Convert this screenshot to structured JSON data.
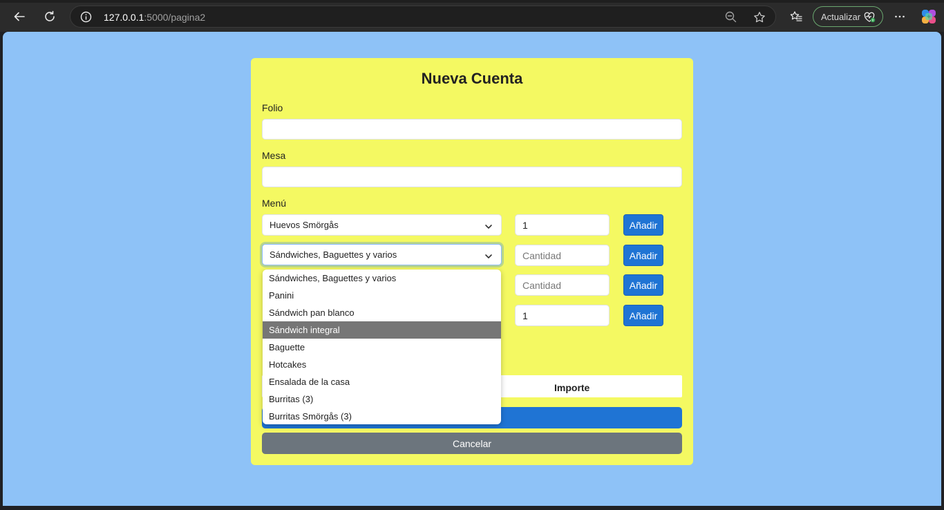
{
  "browser": {
    "url_host": "127.0.0.1",
    "url_path": ":5000/pagina2",
    "update_label": "Actualizar"
  },
  "form": {
    "title": "Nueva Cuenta",
    "folio_label": "Folio",
    "folio_value": "",
    "mesa_label": "Mesa",
    "mesa_value": "",
    "menu_label": "Menú",
    "rows": [
      {
        "selected": "Huevos Smörgås",
        "quantity": "1",
        "quantity_placeholder": "Cantidad",
        "add_label": "Añadir"
      },
      {
        "selected": "Sándwiches, Baguettes y varios",
        "quantity": "",
        "quantity_placeholder": "Cantidad",
        "add_label": "Añadir"
      },
      {
        "selected": "",
        "quantity": "",
        "quantity_placeholder": "Cantidad",
        "add_label": "Añadir"
      },
      {
        "selected": "",
        "quantity": "1",
        "quantity_placeholder": "Cantidad",
        "add_label": "Añadir"
      }
    ],
    "table_header_importe": "Importe",
    "cancel_label": "Cancelar"
  },
  "dropdown": {
    "options": [
      "Sándwiches, Baguettes y varios",
      "Panini",
      "Sándwich pan blanco",
      "Sándwich integral",
      "Baguette",
      "Hotcakes",
      "Ensalada de la casa",
      "Burritas (3)",
      "Burritas Smörgås (3)"
    ],
    "highlighted": "Sándwich integral"
  },
  "colors": {
    "page_bg": "#8ec2f7",
    "card_bg": "#f4f962",
    "primary": "#1f74d4",
    "secondary": "#6c757d"
  }
}
